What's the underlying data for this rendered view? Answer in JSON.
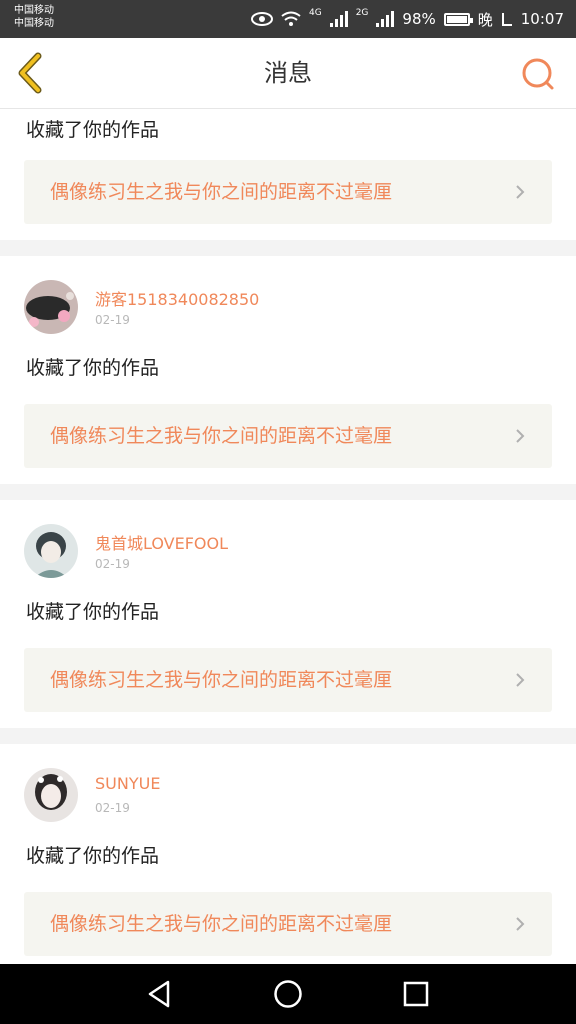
{
  "status": {
    "carrier1": "中国移动",
    "carrier2": "中国移动",
    "net1": "4G",
    "net2": "2G",
    "battery": "98%",
    "night": "晚",
    "time": "10:07"
  },
  "header": {
    "title": "消息"
  },
  "partial_entry": {
    "action": "收藏了你的作品",
    "work_title": "偶像练习生之我与你之间的距离不过毫厘"
  },
  "entries": [
    {
      "username": "游客1518340082850",
      "date": "02-19",
      "action": "收藏了你的作品",
      "work_title": "偶像练习生之我与你之间的距离不过毫厘"
    },
    {
      "username": "鬼首城LOVEFOOL",
      "date": "02-19",
      "action": "收藏了你的作品",
      "work_title": "偶像练习生之我与你之间的距离不过毫厘"
    },
    {
      "username": "SUNYUE",
      "date": "02-19",
      "action": "收藏了你的作品",
      "work_title": "偶像练习生之我与你之间的距离不过毫厘"
    }
  ],
  "colors": {
    "accent": "#f0885a",
    "back_icon": "#f0c020",
    "card_bg": "#f5f5f0"
  },
  "icons": [
    "back-arrow-icon",
    "search-icon",
    "chevron-right-icon",
    "nav-back-icon",
    "nav-home-icon",
    "nav-recents-icon"
  ]
}
